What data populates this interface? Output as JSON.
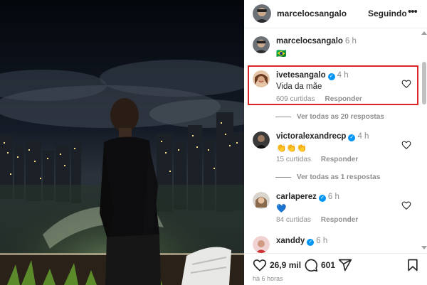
{
  "post": {
    "author": "marcelocsangalo",
    "follow_label": "Seguindo",
    "more_label": "•••",
    "caption_user": "marcelocsangalo",
    "caption_time": "6 h",
    "caption_emoji": "🇧🇷"
  },
  "comments": [
    {
      "user": "ivetesangalo",
      "time": "4 h",
      "verified": true,
      "text": "Vida da mãe",
      "likes": "609 curtidas",
      "reply": "Responder",
      "view_replies": "Ver todas as 20 respostas"
    },
    {
      "user": "victoralexandrecp",
      "time": "4 h",
      "verified": true,
      "text": "👏👏👏",
      "likes": "15 curtidas",
      "reply": "Responder",
      "view_replies": "Ver todas as 1 respostas"
    },
    {
      "user": "carlaperez",
      "time": "6 h",
      "verified": true,
      "text": "💙",
      "likes": "84 curtidas",
      "reply": "Responder"
    },
    {
      "user": "xanddy",
      "time": "6 h",
      "verified": true,
      "text": ""
    }
  ],
  "actions": {
    "likes": "26,9 mil",
    "comments": "601",
    "time_ago": "há 6 horas"
  },
  "icons": [
    "heart-icon",
    "comment-icon",
    "share-icon",
    "bookmark-icon",
    "verified-badge-icon"
  ],
  "colors": {
    "verified_blue": "#0095f6",
    "highlight_red": "#e02424",
    "muted_text": "#8e8e8e"
  }
}
